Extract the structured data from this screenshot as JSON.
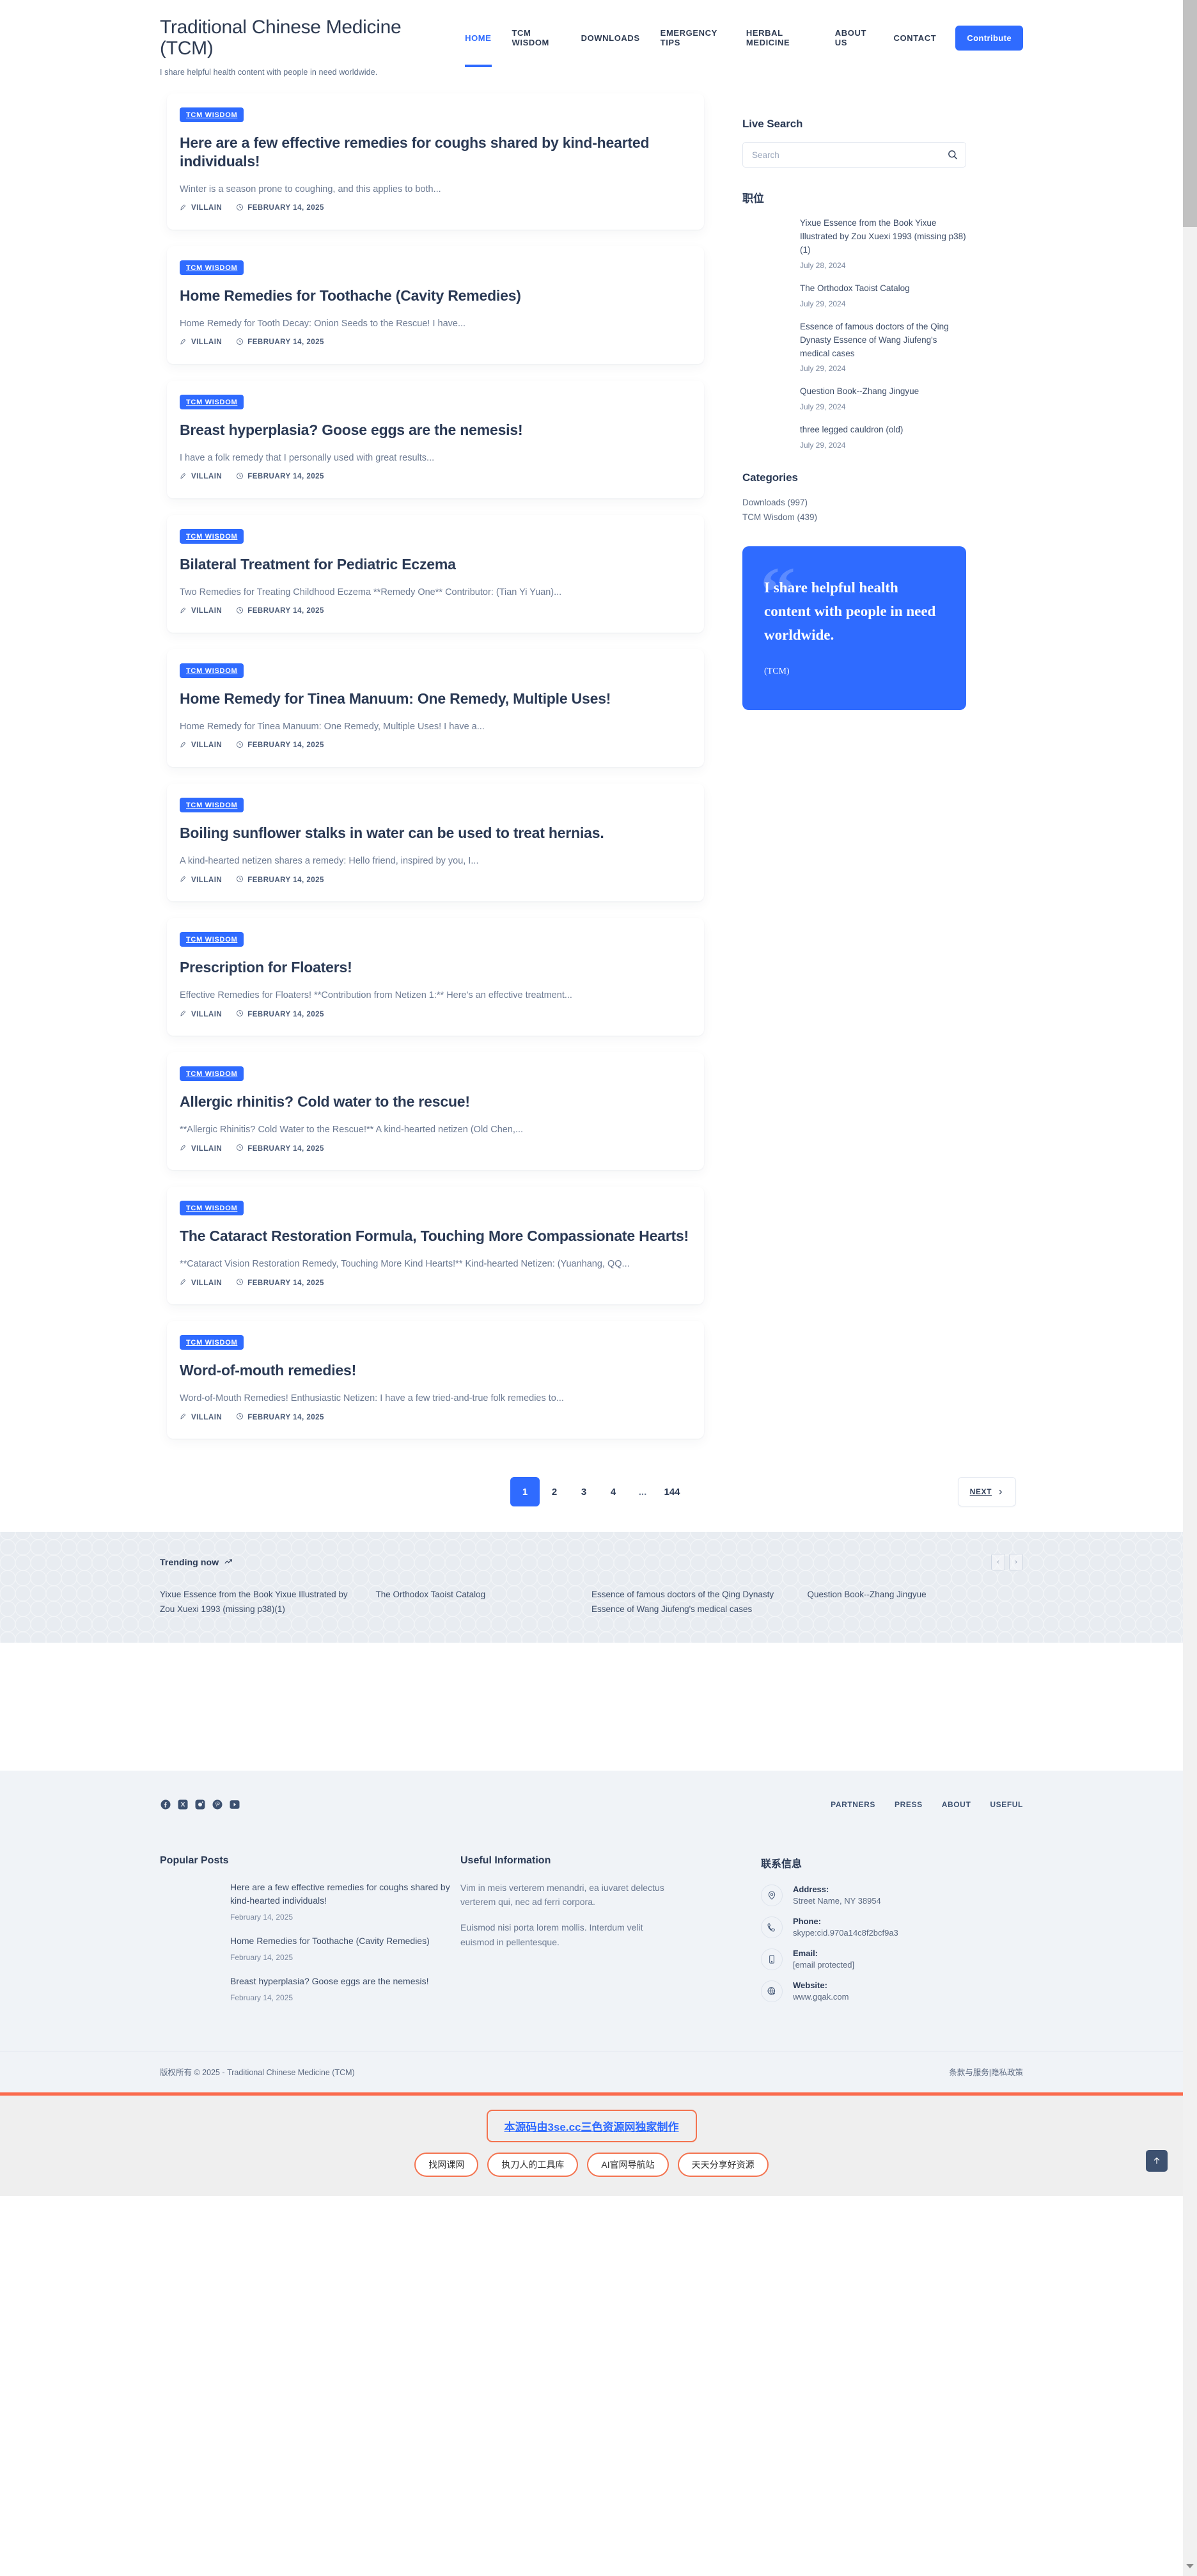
{
  "header": {
    "brand_title": "Traditional Chinese Medicine (TCM)",
    "tagline": "I share helpful health content with people in need worldwide.",
    "nav": [
      {
        "label": "HOME",
        "active": true
      },
      {
        "label": "TCM WISDOM",
        "active": false
      },
      {
        "label": "DOWNLOADS",
        "active": false
      },
      {
        "label": "EMERGENCY TIPS",
        "active": false
      },
      {
        "label": "HERBAL MEDICINE",
        "active": false
      },
      {
        "label": "ABOUT US",
        "active": false
      },
      {
        "label": "CONTACT",
        "active": false
      }
    ],
    "cta_label": "Contribute"
  },
  "posts": [
    {
      "category": "TCM WISDOM",
      "title": "Here are a few effective remedies for coughs shared by kind-hearted individuals!",
      "excerpt": "Winter is a season prone to coughing, and this applies to both...",
      "author": "VILLAIN",
      "date": "FEBRUARY 14, 2025"
    },
    {
      "category": "TCM WISDOM",
      "title": "Home Remedies for Toothache (Cavity Remedies)",
      "excerpt": "Home Remedy for Tooth Decay: Onion Seeds to the Rescue! I have...",
      "author": "VILLAIN",
      "date": "FEBRUARY 14, 2025"
    },
    {
      "category": "TCM WISDOM",
      "title": "Breast hyperplasia? Goose eggs are the nemesis!",
      "excerpt": "I have a folk remedy that I personally used with great results...",
      "author": "VILLAIN",
      "date": "FEBRUARY 14, 2025"
    },
    {
      "category": "TCM WISDOM",
      "title": "Bilateral Treatment for Pediatric Eczema",
      "excerpt": "Two Remedies for Treating Childhood Eczema **Remedy One** Contributor: (Tian Yi Yuan)...",
      "author": "VILLAIN",
      "date": "FEBRUARY 14, 2025"
    },
    {
      "category": "TCM WISDOM",
      "title": "Home Remedy for Tinea Manuum: One Remedy, Multiple Uses!",
      "excerpt": "Home Remedy for Tinea Manuum: One Remedy, Multiple Uses! I have a...",
      "author": "VILLAIN",
      "date": "FEBRUARY 14, 2025"
    },
    {
      "category": "TCM WISDOM",
      "title": "Boiling sunflower stalks in water can be used to treat hernias.",
      "excerpt": "A kind-hearted netizen shares a remedy: Hello friend, inspired by you, I...",
      "author": "VILLAIN",
      "date": "FEBRUARY 14, 2025"
    },
    {
      "category": "TCM WISDOM",
      "title": "Prescription for Floaters!",
      "excerpt": "Effective Remedies for Floaters! **Contribution from Netizen 1:** Here's an effective treatment...",
      "author": "VILLAIN",
      "date": "FEBRUARY 14, 2025"
    },
    {
      "category": "TCM WISDOM",
      "title": "Allergic rhinitis? Cold water to the rescue!",
      "excerpt": "**Allergic Rhinitis? Cold Water to the Rescue!** A kind-hearted netizen (Old Chen,...",
      "author": "VILLAIN",
      "date": "FEBRUARY 14, 2025"
    },
    {
      "category": "TCM WISDOM",
      "title": "The Cataract Restoration Formula, Touching More Compassionate Hearts!",
      "excerpt": "**Cataract Vision Restoration Remedy, Touching More Kind Hearts!** Kind-hearted Netizen: (Yuanhang, QQ...",
      "author": "VILLAIN",
      "date": "FEBRUARY 14, 2025"
    },
    {
      "category": "TCM WISDOM",
      "title": "Word-of-mouth remedies!",
      "excerpt": "Word-of-Mouth Remedies! Enthusiastic Netizen: I have a few tried-and-true folk remedies to...",
      "author": "VILLAIN",
      "date": "FEBRUARY 14, 2025"
    }
  ],
  "pagination": {
    "pages": [
      "1",
      "2",
      "3",
      "4",
      "...",
      "144"
    ],
    "current": "1",
    "next_label": "NEXT"
  },
  "sidebar": {
    "search_title": "Live Search",
    "search_placeholder": "Search",
    "search_value": "",
    "posts_title": "职位",
    "posts": [
      {
        "title": "Yixue Essence from the Book Yixue Illustrated by Zou Xuexi 1993 (missing p38)(1)",
        "date": "July 28, 2024"
      },
      {
        "title": "The Orthodox Taoist Catalog",
        "date": "July 29, 2024"
      },
      {
        "title": "Essence of famous doctors of the Qing Dynasty Essence of Wang Jiufeng's medical cases",
        "date": "July 29, 2024"
      },
      {
        "title": "Question Book--Zhang Jingyue",
        "date": "July 29, 2024"
      },
      {
        "title": "three legged cauldron (old)",
        "date": "July 29, 2024"
      }
    ],
    "categories_title": "Categories",
    "categories": [
      "Downloads (997)",
      "TCM Wisdom (439)"
    ],
    "quote_text": "I share helpful health content with people in need worldwide.",
    "quote_author": "(TCM)",
    "quote_color": "#2f6bff"
  },
  "trending": {
    "label": "Trending now",
    "items": [
      "Yixue Essence from the Book Yixue Illustrated by Zou Xuexi 1993 (missing p38)(1)",
      "The Orthodox Taoist Catalog",
      "Essence of famous doctors of the Qing Dynasty Essence of Wang Jiufeng's medical cases",
      "Question Book--Zhang Jingyue"
    ],
    "prev": "‹",
    "next": "›"
  },
  "footer": {
    "socials": [
      "facebook-icon",
      "x-twitter-icon",
      "instagram-icon",
      "pinterest-icon",
      "youtube-icon"
    ],
    "links": [
      "PARTNERS",
      "PRESS",
      "ABOUT",
      "USEFUL"
    ],
    "popular_title": "Popular Posts",
    "popular": [
      {
        "title": "Here are a few effective remedies for coughs shared by kind-hearted individuals!",
        "date": "February 14, 2025"
      },
      {
        "title": "Home Remedies for Toothache (Cavity Remedies)",
        "date": "February 14, 2025"
      },
      {
        "title": "Breast hyperplasia? Goose eggs are the nemesis!",
        "date": "February 14, 2025"
      }
    ],
    "useful_title": "Useful Information",
    "useful_p1": "Vim in meis verterem menandri, ea iuvaret delectus verterem qui, nec ad ferri corpora.",
    "useful_p2": "Euismod nisi porta lorem mollis. Interdum velit euismod in pellentesque.",
    "contact_title": "联系信息",
    "contacts": [
      {
        "icon": "map-pin-icon",
        "label": "Address:",
        "value": "Street Name, NY 38954"
      },
      {
        "icon": "phone-icon",
        "label": "Phone:",
        "value": "skype:cid.970a14c8f2bcf9a3"
      },
      {
        "icon": "mobile-icon",
        "label": "Email:",
        "value": "[email protected]"
      },
      {
        "icon": "globe-cursor-icon",
        "label": "Website:",
        "value": "www.gqak.com"
      }
    ],
    "copyright": "版权所有 © 2025 - Traditional Chinese Medicine (TCM)",
    "terms": "条款与服务|隐私政策"
  },
  "promo": {
    "main": "本源码由3se.cc三色资源网独家制作",
    "pills": [
      "找网课网",
      "执刀人的工具库",
      "AI官网导航站",
      "天天分享好资源"
    ],
    "accent": "#f4734f"
  }
}
